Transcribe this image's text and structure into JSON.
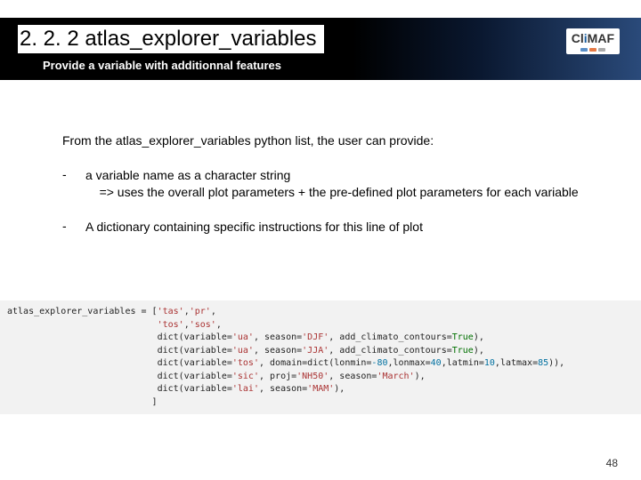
{
  "header": {
    "title": "2. 2. 2 atlas_explorer_variables",
    "subtitle": "Provide a variable with additionnal features",
    "logo_main": "CliMAF",
    "logo_i": "i"
  },
  "body": {
    "intro": "From the atlas_explorer_variables python list, the user can provide:",
    "bullet1_dash": "-",
    "bullet1_line1": "a variable name as a character string",
    "bullet1_line2": "=> uses the overall plot parameters + the pre-defined plot parameters for each variable",
    "bullet2_dash": "-",
    "bullet2_text": "A dictionary containing specific instructions for this line of plot"
  },
  "code": {
    "l1a": "atlas_explorer_variables = [",
    "l1b": "'tas'",
    "l1c": ",",
    "l1d": "'pr'",
    "l1e": ",",
    "pad": "                            ",
    "l2a": "'tos'",
    "l2b": ",",
    "l2c": "'sos'",
    "l2d": ",",
    "l3a": "dict(variable=",
    "l3b": "'ua'",
    "l3c": ", season=",
    "l3d": "'DJF'",
    "l3e": ", add_climato_contours=",
    "l3f": "True",
    "l3g": "),",
    "l4a": "dict(variable=",
    "l4b": "'ua'",
    "l4c": ", season=",
    "l4d": "'JJA'",
    "l4e": ", add_climato_contours=",
    "l4f": "True",
    "l4g": "),",
    "l5a": "dict(variable=",
    "l5b": "'tos'",
    "l5c": ", domain=dict(lonmin=",
    "l5d": "-80",
    "l5e": ",lonmax=",
    "l5f": "40",
    "l5g": ",latmin=",
    "l5h": "10",
    "l5i": ",latmax=",
    "l5j": "85",
    "l5k": ")),",
    "l6a": "dict(variable=",
    "l6b": "'sic'",
    "l6c": ", proj=",
    "l6d": "'NH50'",
    "l6e": ", season=",
    "l6f": "'March'",
    "l6g": "),",
    "l7a": "dict(variable=",
    "l7b": "'lai'",
    "l7c": ", season=",
    "l7d": "'MAM'",
    "l7e": "),",
    "l8": "                           ]"
  },
  "page_number": "48"
}
